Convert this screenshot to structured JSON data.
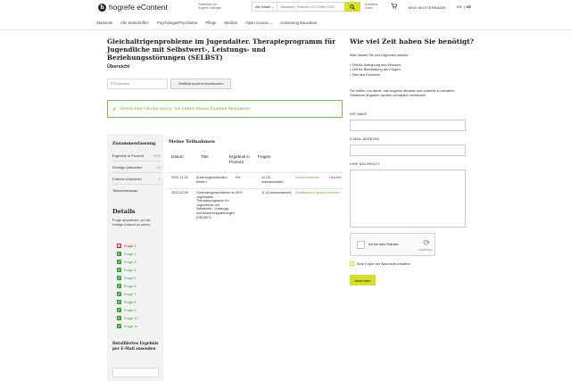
{
  "header": {
    "logo_mark": "h",
    "logo_text": "hogrefe eContent",
    "tenant_line1": "Präsentiert von",
    "tenant_line2": "Hogrefe Göttingen",
    "search_scope": "Alle Inhalte",
    "search_placeholder": "Stichwörter | Personen | DOI | ISBN | ISSN",
    "advanced_search_line1": "Erweiterte",
    "advanced_search_line2": "Suche",
    "user": "MAX MUSTERMANN",
    "lang_en": "EN",
    "lang_de": "DE",
    "lang_sep": "|"
  },
  "nav": {
    "items": [
      "Startseite",
      "Alle Zeitschriften",
      "Psychologie/Psychiatrie",
      "Pflege",
      "Medizin",
      "Open Access ⌄",
      "Continuing Education"
    ]
  },
  "main": {
    "title": "Gleichaltrigenprobleme im Jugendalter. Therapieprogramm für Jugendliche mit Selbstwert-, Leistungs- und Beziehungsstörungen (SELBST)",
    "overview": "Übersicht",
    "ptn_placeholder": "PTN Nummer",
    "cert_button": "Zertifikat ansehen/ausdrucken",
    "success_icon": "✓",
    "success_text": "Herzlichen Glückwunsch, Sie haben dieses Examen bestanden."
  },
  "sidebar": {
    "summary_title": "Zusammenfassung",
    "rows": [
      {
        "label": "Ergebnis in Prozent",
        "value": "90%"
      },
      {
        "label": "Richtige Antworten",
        "value": "10"
      },
      {
        "label": "Falsche Antworten",
        "value": "1"
      },
      {
        "label": "Teilnahmedauer",
        "value": ""
      }
    ],
    "details_title": "Details",
    "details_note": "Frage auswählen, um die richtige Antwort zu sehen",
    "questions": [
      {
        "label": "Frage 1",
        "correct": false
      },
      {
        "label": "Frage 2",
        "correct": true
      },
      {
        "label": "Frage 3",
        "correct": true
      },
      {
        "label": "Frage 4",
        "correct": true
      },
      {
        "label": "Frage 5",
        "correct": true
      },
      {
        "label": "Frage 6",
        "correct": true
      },
      {
        "label": "Frage 7",
        "correct": true
      },
      {
        "label": "Frage 8",
        "correct": true
      },
      {
        "label": "Frage 9",
        "correct": true
      },
      {
        "label": "Frage 10",
        "correct": true
      },
      {
        "label": "Frage 11",
        "correct": true
      }
    ],
    "detailed_results_title": "Detailliertes Ergebnis per E-Mail zusenden"
  },
  "participations": {
    "title": "Meine Teilnahmen",
    "headers": {
      "date": "Datum",
      "title": "Titel",
      "result": "Ergebnis in Prozent",
      "questions": "Fragen"
    },
    "rows": [
      {
        "date": "2022-11-15",
        "title": "Änderungsmotivation fördern",
        "result": "0%",
        "questions": "10 (10 unbeantwortet)",
        "action1": "Modul fortsetzen",
        "action2": "Löschen"
      },
      {
        "date": "2022-02-09",
        "title": "Gleichaltrigenprobleme im Jugendalter. Therapieprogramm für Jugendliche mit Selbstwert-, Leistungs- und Beziehungsstörungen (SELBST)",
        "result": "90%",
        "questions": "11 (0 unbeantwortet)",
        "action1": "Detailliertes Ergebnis ansehen",
        "action2": ""
      }
    ]
  },
  "contact": {
    "title": "Wie viel Zeit haben Sie benötigt?",
    "intro": "Bitte lassen Sie uns folgendes wissen:",
    "bullets": [
      "Zeit für Aneignung des Wissens",
      "Zeit für Bearbeitung der Fragen",
      "Titel des Examens"
    ],
    "help": "Sie helfen uns damit, das Angebot attraktiv und aufrecht zu erhalten. Sämtliche Angaben werden vertraulich behandelt.",
    "name_label": "IHR NAME",
    "email_label": "E-MAIL-ADRESSE",
    "message_label": "IHRE NACHRICHT",
    "captcha_text": "Ich bin kein Roboter.",
    "captcha_brand": "reCAPTCHA",
    "copy_label": "Eine Kopie der Nachricht erhalten",
    "send_button": "Absenden"
  },
  "colors": {
    "accent": "#d6e02a",
    "success": "#6cb23b",
    "error": "#dd2222"
  }
}
